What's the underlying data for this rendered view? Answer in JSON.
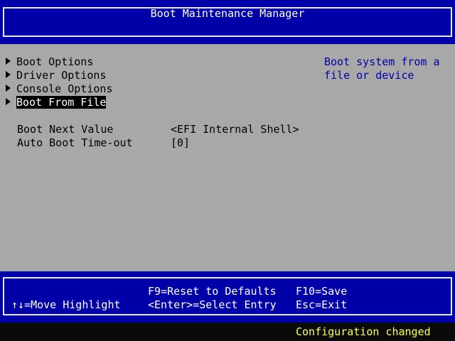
{
  "header": {
    "title": "Boot Maintenance Manager"
  },
  "menu": {
    "items": [
      {
        "label": "Boot Options",
        "icon": "triangle-right-icon"
      },
      {
        "label": "Driver Options",
        "icon": "triangle-right-icon"
      },
      {
        "label": "Console Options",
        "icon": "triangle-right-icon"
      },
      {
        "label": "Boot From File",
        "icon": "triangle-right-icon",
        "selected": true
      }
    ]
  },
  "fields": [
    {
      "label": "Boot Next Value",
      "value": "<EFI Internal Shell>"
    },
    {
      "label": "Auto Boot Time-out",
      "value": "[0]"
    }
  ],
  "help": {
    "lines": [
      "Boot system from a",
      "file or device"
    ]
  },
  "footer": {
    "move_highlight": "↑↓=Move Highlight",
    "reset_defaults": "F9=Reset to Defaults",
    "select_entry": "<Enter>=Select Entry",
    "save": "F10=Save",
    "exit": "Esc=Exit"
  },
  "status": {
    "message": "Configuration changed"
  },
  "colors": {
    "header_background": "#0000a8",
    "body_background": "#a8a8a8",
    "help_text": "#0000a8",
    "status_text": "#ffff55"
  }
}
